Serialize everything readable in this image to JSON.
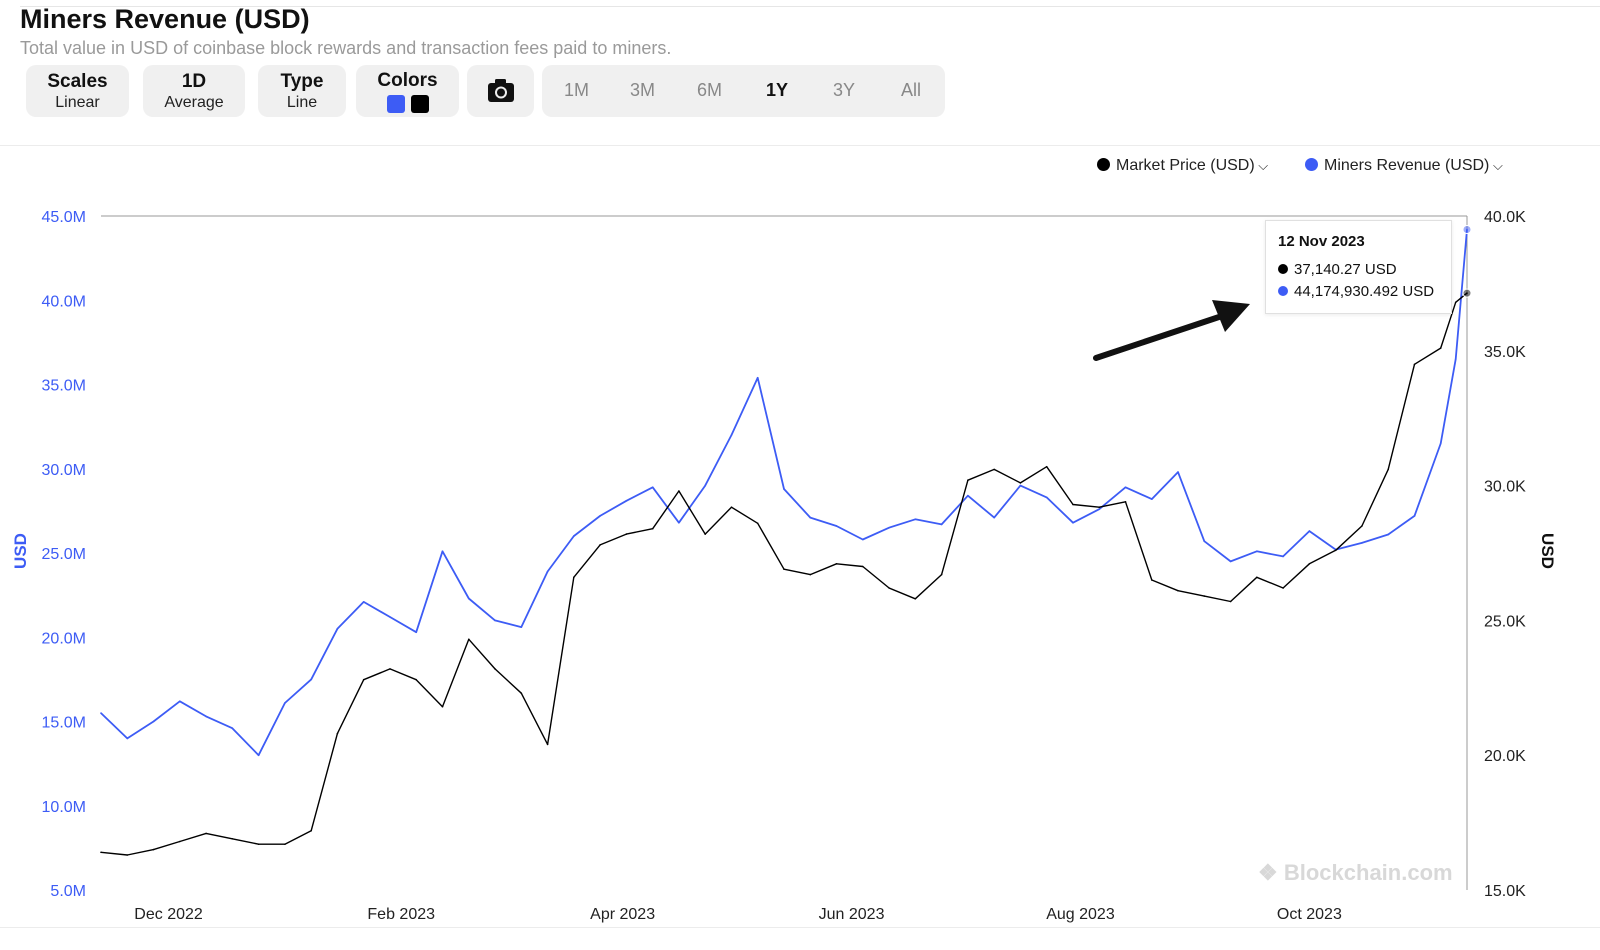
{
  "header": {
    "title": "Miners Revenue (USD)",
    "subtitle": "Total value in USD of coinbase block rewards and transaction fees paid to miners."
  },
  "toolbar": {
    "scales": {
      "label": "Scales",
      "value": "Linear"
    },
    "period": {
      "label": "1D",
      "value": "Average"
    },
    "type": {
      "label": "Type",
      "value": "Line"
    },
    "colors": {
      "label": "Colors",
      "swatches": [
        "#3d5cf5",
        "#000000"
      ]
    },
    "camera_icon": "camera-icon",
    "ranges": [
      "1M",
      "3M",
      "6M",
      "1Y",
      "3Y",
      "All"
    ],
    "active_range": "1Y"
  },
  "legend": [
    {
      "label": "Market Price (USD)",
      "color": "#000000"
    },
    {
      "label": "Miners Revenue (USD)",
      "color": "#3d5cf5"
    }
  ],
  "tooltip": {
    "date": "12 Nov 2023",
    "price": "37,140.27 USD",
    "revenue": "44,174,930.492 USD"
  },
  "watermark": "Blockchain.com",
  "chart_data": {
    "type": "line",
    "x_start": "2022-11-13",
    "x_end": "2023-11-12",
    "x_ticks": [
      "Dec 2022",
      "Feb 2023",
      "Apr 2023",
      "Jun 2023",
      "Aug 2023",
      "Oct 2023"
    ],
    "y_left": {
      "label": "USD",
      "ticks": [
        "5.0M",
        "10.0M",
        "15.0M",
        "20.0M",
        "25.0M",
        "30.0M",
        "35.0M",
        "40.0M",
        "45.0M"
      ],
      "range": [
        5000000,
        45000000
      ],
      "color": "#3d5cf5"
    },
    "y_right": {
      "label": "USD",
      "ticks": [
        "15.0K",
        "20.0K",
        "25.0K",
        "30.0K",
        "35.0K",
        "40.0K"
      ],
      "range": [
        15000,
        40000
      ]
    },
    "series": [
      {
        "name": "Miners Revenue (USD)",
        "axis": "left",
        "color": "#3d5cf5",
        "x": [
          "2022-11-13",
          "2022-11-20",
          "2022-11-27",
          "2022-12-04",
          "2022-12-11",
          "2022-12-18",
          "2022-12-25",
          "2023-01-01",
          "2023-01-08",
          "2023-01-15",
          "2023-01-22",
          "2023-01-29",
          "2023-02-05",
          "2023-02-12",
          "2023-02-19",
          "2023-02-26",
          "2023-03-05",
          "2023-03-12",
          "2023-03-19",
          "2023-03-26",
          "2023-04-02",
          "2023-04-09",
          "2023-04-16",
          "2023-04-23",
          "2023-04-30",
          "2023-05-07",
          "2023-05-14",
          "2023-05-21",
          "2023-05-28",
          "2023-06-04",
          "2023-06-11",
          "2023-06-18",
          "2023-06-25",
          "2023-07-02",
          "2023-07-09",
          "2023-07-16",
          "2023-07-23",
          "2023-07-30",
          "2023-08-06",
          "2023-08-13",
          "2023-08-20",
          "2023-08-27",
          "2023-09-03",
          "2023-09-10",
          "2023-09-17",
          "2023-09-24",
          "2023-10-01",
          "2023-10-08",
          "2023-10-15",
          "2023-10-22",
          "2023-10-29",
          "2023-11-05",
          "2023-11-09",
          "2023-11-12"
        ],
        "values": [
          15500000,
          14000000,
          15000000,
          16200000,
          15300000,
          14600000,
          13000000,
          16100000,
          17500000,
          20500000,
          22100000,
          21200000,
          20300000,
          25100000,
          22300000,
          21000000,
          20600000,
          23900000,
          26000000,
          27200000,
          28100000,
          28900000,
          26800000,
          29000000,
          32000000,
          35400000,
          28800000,
          27100000,
          26600000,
          25800000,
          26500000,
          27000000,
          26700000,
          28400000,
          27100000,
          29000000,
          28300000,
          26800000,
          27600000,
          28900000,
          28200000,
          29800000,
          25700000,
          24500000,
          25100000,
          24800000,
          26300000,
          25200000,
          25600000,
          26100000,
          27200000,
          31500000,
          36500000,
          44200000
        ]
      },
      {
        "name": "Market Price (USD)",
        "axis": "right",
        "color": "#000000",
        "x": [
          "2022-11-13",
          "2022-11-20",
          "2022-11-27",
          "2022-12-04",
          "2022-12-11",
          "2022-12-18",
          "2022-12-25",
          "2023-01-01",
          "2023-01-08",
          "2023-01-15",
          "2023-01-22",
          "2023-01-29",
          "2023-02-05",
          "2023-02-12",
          "2023-02-19",
          "2023-02-26",
          "2023-03-05",
          "2023-03-12",
          "2023-03-19",
          "2023-03-26",
          "2023-04-02",
          "2023-04-09",
          "2023-04-16",
          "2023-04-23",
          "2023-04-30",
          "2023-05-07",
          "2023-05-14",
          "2023-05-21",
          "2023-05-28",
          "2023-06-04",
          "2023-06-11",
          "2023-06-18",
          "2023-06-25",
          "2023-07-02",
          "2023-07-09",
          "2023-07-16",
          "2023-07-23",
          "2023-07-30",
          "2023-08-06",
          "2023-08-13",
          "2023-08-20",
          "2023-08-27",
          "2023-09-03",
          "2023-09-10",
          "2023-09-17",
          "2023-09-24",
          "2023-10-01",
          "2023-10-08",
          "2023-10-15",
          "2023-10-22",
          "2023-10-29",
          "2023-11-05",
          "2023-11-09",
          "2023-11-12"
        ],
        "values": [
          16400,
          16300,
          16500,
          16800,
          17100,
          16900,
          16700,
          16700,
          17200,
          20800,
          22800,
          23200,
          22800,
          21800,
          24300,
          23200,
          22300,
          20400,
          26600,
          27800,
          28200,
          28400,
          29800,
          28200,
          29200,
          28600,
          26900,
          26700,
          27100,
          27000,
          26200,
          25800,
          26700,
          30200,
          30600,
          30100,
          30700,
          29300,
          29200,
          29400,
          26500,
          26100,
          25900,
          25700,
          26600,
          26200,
          27100,
          27600,
          28500,
          30600,
          34500,
          35100,
          36800,
          37140
        ]
      }
    ],
    "annotation": "arrow pointing at last data point",
    "grid": false,
    "legend_position": "top-right"
  }
}
